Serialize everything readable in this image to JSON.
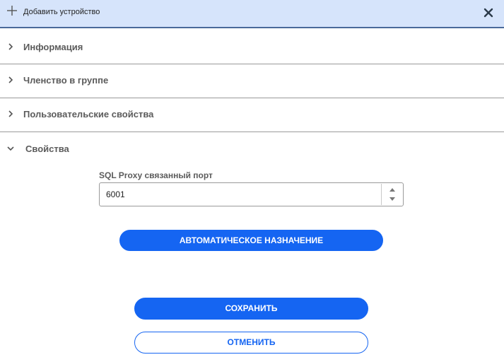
{
  "header": {
    "title": "Добавить устройство"
  },
  "sections": [
    {
      "label": "Информация",
      "expanded": false
    },
    {
      "label": "Членство в группе",
      "expanded": false
    },
    {
      "label": "Пользовательские свойства",
      "expanded": false
    },
    {
      "label": "Свойства",
      "expanded": true
    }
  ],
  "properties": {
    "sql_proxy_port_label": "SQL Proxy связанный порт",
    "sql_proxy_port_value": "6001",
    "auto_assign_label": "АВТОМАТИЧЕСКОЕ НАЗНАЧЕНИЕ"
  },
  "actions": {
    "save_label": "СОХРАНИТЬ",
    "cancel_label": "ОТМЕНИТЬ"
  },
  "colors": {
    "header_bg": "#d6e4fb",
    "accent": "#1565f2",
    "section_text": "#5b5b5b"
  }
}
